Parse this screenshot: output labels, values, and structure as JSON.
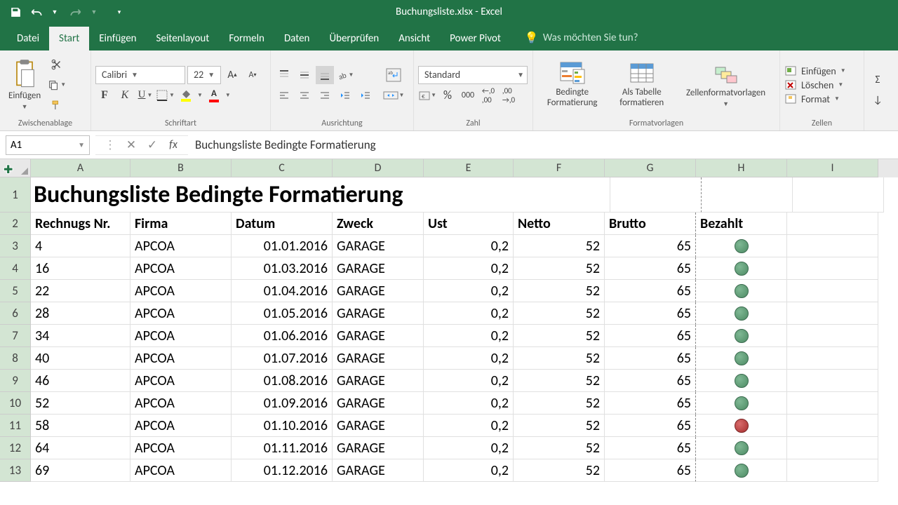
{
  "title": "Buchungsliste.xlsx - Excel",
  "tabs": {
    "file": "Datei",
    "active": "Start",
    "others": [
      "Einfügen",
      "Seitenlayout",
      "Formeln",
      "Daten",
      "Überprüfen",
      "Ansicht",
      "Power Pivot"
    ],
    "tellme": "Was möchten Sie tun?"
  },
  "ribbon": {
    "clipboard": {
      "paste": "Einfügen",
      "label": "Zwischenablage"
    },
    "font": {
      "name": "Calibri",
      "size": "22",
      "bold": "F",
      "italic": "K",
      "underline": "U",
      "label": "Schriftart"
    },
    "alignment": {
      "label": "Ausrichtung"
    },
    "number": {
      "format": "Standard",
      "label": "Zahl"
    },
    "styles": {
      "condfmt": "Bedingte\nFormatierung",
      "table": "Als Tabelle\nformatieren",
      "cellstyles": "Zellenformatvorlagen",
      "label": "Formatvorlagen"
    },
    "cells": {
      "insert": "Einfügen",
      "delete": "Löschen",
      "format": "Format",
      "label": "Zellen"
    }
  },
  "namebox": "A1",
  "formula": "Buchungsliste Bedingte Formatierung",
  "columns": [
    "A",
    "B",
    "C",
    "D",
    "E",
    "F",
    "G",
    "H",
    "I"
  ],
  "sheet": {
    "title": "Buchungsliste Bedingte Formatierung",
    "headers": {
      "A": "Rechnugs Nr.",
      "B": "Firma",
      "C": "Datum",
      "D": "Zweck",
      "E": "Ust",
      "F": "Netto",
      "G": "Brutto",
      "H": "Bezahlt"
    },
    "rows": [
      {
        "nr": "4",
        "firma": "APCOA",
        "datum": "01.01.2016",
        "zweck": "GARAGE",
        "ust": "0,2",
        "netto": "52",
        "brutto": "65",
        "paid": "green"
      },
      {
        "nr": "16",
        "firma": "APCOA",
        "datum": "01.03.2016",
        "zweck": "GARAGE",
        "ust": "0,2",
        "netto": "52",
        "brutto": "65",
        "paid": "green"
      },
      {
        "nr": "22",
        "firma": "APCOA",
        "datum": "01.04.2016",
        "zweck": "GARAGE",
        "ust": "0,2",
        "netto": "52",
        "brutto": "65",
        "paid": "green"
      },
      {
        "nr": "28",
        "firma": "APCOA",
        "datum": "01.05.2016",
        "zweck": "GARAGE",
        "ust": "0,2",
        "netto": "52",
        "brutto": "65",
        "paid": "green"
      },
      {
        "nr": "34",
        "firma": "APCOA",
        "datum": "01.06.2016",
        "zweck": "GARAGE",
        "ust": "0,2",
        "netto": "52",
        "brutto": "65",
        "paid": "green"
      },
      {
        "nr": "40",
        "firma": "APCOA",
        "datum": "01.07.2016",
        "zweck": "GARAGE",
        "ust": "0,2",
        "netto": "52",
        "brutto": "65",
        "paid": "green"
      },
      {
        "nr": "46",
        "firma": "APCOA",
        "datum": "01.08.2016",
        "zweck": "GARAGE",
        "ust": "0,2",
        "netto": "52",
        "brutto": "65",
        "paid": "green"
      },
      {
        "nr": "52",
        "firma": "APCOA",
        "datum": "01.09.2016",
        "zweck": "GARAGE",
        "ust": "0,2",
        "netto": "52",
        "brutto": "65",
        "paid": "green"
      },
      {
        "nr": "58",
        "firma": "APCOA",
        "datum": "01.10.2016",
        "zweck": "GARAGE",
        "ust": "0,2",
        "netto": "52",
        "brutto": "65",
        "paid": "red"
      },
      {
        "nr": "64",
        "firma": "APCOA",
        "datum": "01.11.2016",
        "zweck": "GARAGE",
        "ust": "0,2",
        "netto": "52",
        "brutto": "65",
        "paid": "green"
      },
      {
        "nr": "69",
        "firma": "APCOA",
        "datum": "01.12.2016",
        "zweck": "GARAGE",
        "ust": "0,2",
        "netto": "52",
        "brutto": "65",
        "paid": "green"
      }
    ]
  }
}
